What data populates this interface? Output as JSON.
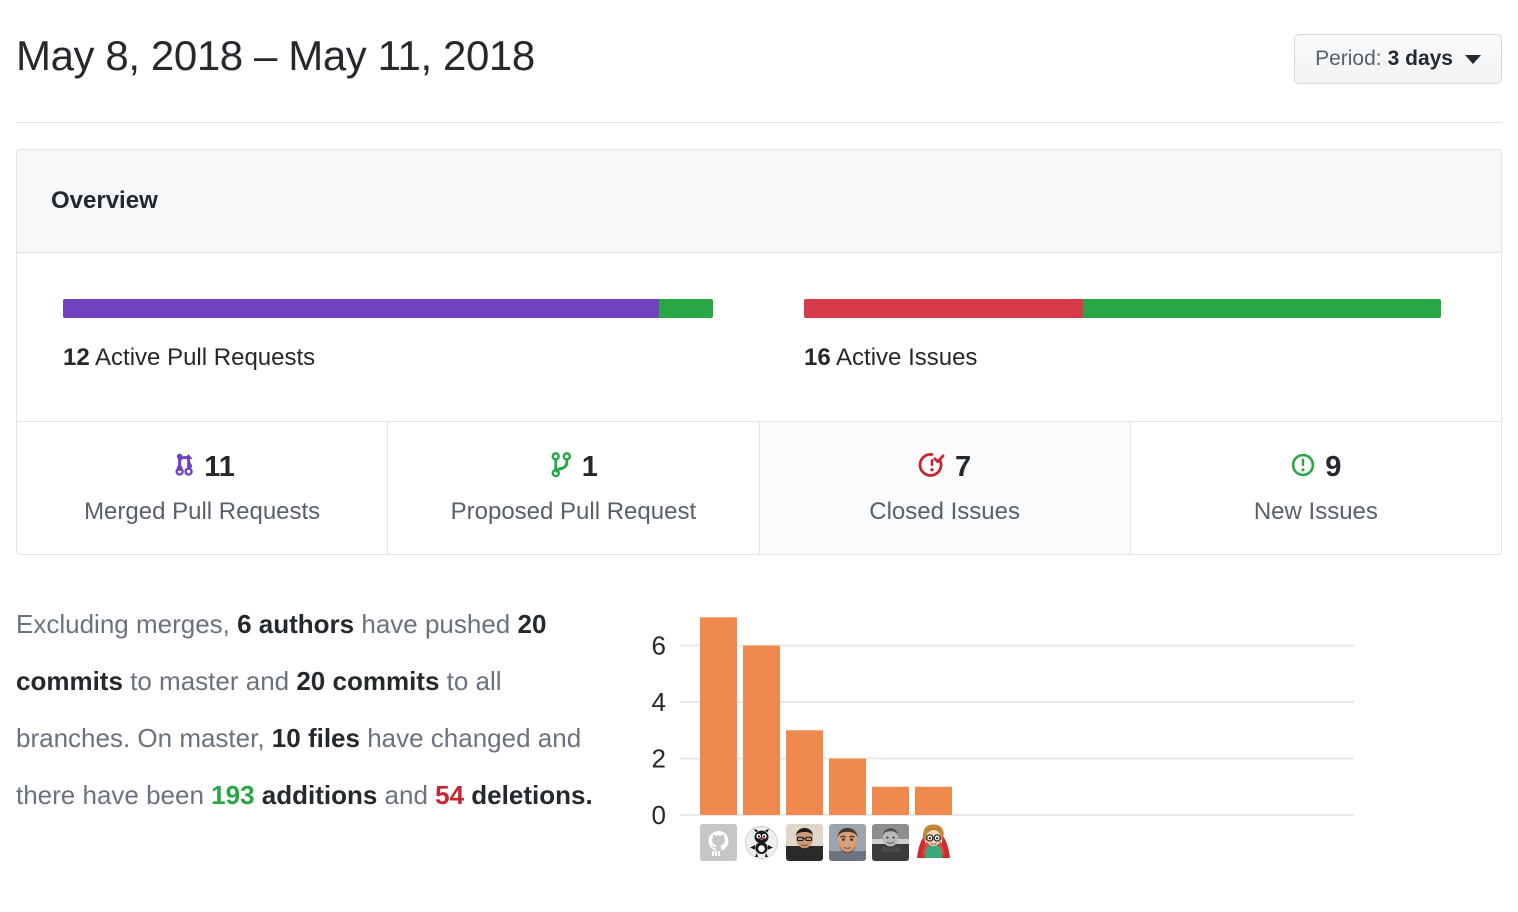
{
  "header": {
    "date_range": "May 8, 2018 – May 11, 2018",
    "period_prefix": "Period:",
    "period_value": "3 days"
  },
  "overview": {
    "title": "Overview",
    "bars": [
      {
        "name": "active-pull-requests",
        "count": "12",
        "label": "Active Pull Requests",
        "segments": [
          {
            "name": "merged",
            "value": 11,
            "percent": 91.7,
            "color": "#6f42c1"
          },
          {
            "name": "proposed",
            "value": 1,
            "percent": 8.3,
            "color": "#28a745"
          }
        ]
      },
      {
        "name": "active-issues",
        "count": "16",
        "label": "Active Issues",
        "segments": [
          {
            "name": "closed",
            "value": 7,
            "percent": 43.75,
            "color": "#d73a49"
          },
          {
            "name": "new",
            "value": 9,
            "percent": 56.25,
            "color": "#28a745"
          }
        ]
      }
    ],
    "stats": [
      {
        "icon": "git-merge-icon",
        "value": "11",
        "label": "Merged Pull Requests",
        "color": "#6f42c1",
        "shaded": false
      },
      {
        "icon": "git-branch-icon",
        "value": "1",
        "label": "Proposed Pull Request",
        "color": "#28a745",
        "shaded": false
      },
      {
        "icon": "issue-closed-icon",
        "value": "7",
        "label": "Closed Issues",
        "color": "#cb2431",
        "shaded": true
      },
      {
        "icon": "issue-opened-icon",
        "value": "9",
        "label": "New Issues",
        "color": "#28a745",
        "shaded": false
      }
    ]
  },
  "summary": {
    "lead": "Excluding merges, ",
    "authors": "6 authors",
    "have_pushed": " have pushed ",
    "commits_master": "20 commits",
    "to_master_and": " to master and ",
    "commits_all": "20 commits",
    "to_all_branches": " to all branches. On master, ",
    "files": "10 files",
    "have_changed": " have changed and there have been ",
    "additions": "193",
    "additions_word": " additions",
    "and": " and ",
    "deletions": "54",
    "deletions_word": " deletions",
    "period": "."
  },
  "chart_data": {
    "type": "bar",
    "title": "",
    "xlabel": "",
    "ylabel": "",
    "categories": [
      "author-1",
      "author-2",
      "author-3",
      "author-4",
      "author-5",
      "author-6"
    ],
    "category_labels": [
      "octocat-avatar",
      "cat-cartoon-avatar",
      "photo-avatar-1",
      "photo-avatar-2",
      "photo-avatar-3-bw",
      "illustration-avatar"
    ],
    "values": [
      7,
      6,
      3,
      2,
      1,
      1
    ],
    "yticks": [
      "0",
      "2",
      "4",
      "6"
    ],
    "ytick_values": [
      0,
      2,
      4,
      6
    ],
    "ylim": [
      0,
      7.4
    ],
    "grid": true,
    "legend": "none",
    "bar_color": "#f0894e",
    "gridline_color": "#e8e8e8"
  }
}
